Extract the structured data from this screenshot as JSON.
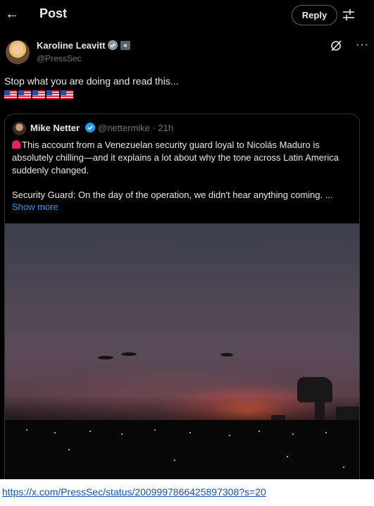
{
  "header": {
    "title": "Post",
    "reply_label": "Reply"
  },
  "author": {
    "name": "Karoline Leavitt",
    "handle": "@PressSec"
  },
  "tweet": {
    "text": "Stop what you are doing and read this..."
  },
  "quote": {
    "name": "Mike Netter",
    "handle": "@nettermike · 21h",
    "body": "This account from a Venezuelan security guard loyal to Nicolás Maduro is absolutely chilling—and it explains a lot about why the tone across Latin America suddenly changed.",
    "para2": "Security Guard: On the day of the operation, we didn't hear anything coming. ...",
    "show_more": "Show more"
  },
  "url": "https://x.com/PressSec/status/2009997866425897308?s=20",
  "colors": {
    "accent": "#1d9bf0",
    "background": "#000000",
    "text": "#e7e9ea",
    "muted": "#71767b"
  },
  "icons": [
    "back-arrow-icon",
    "settings-sliders-icon",
    "verified-badge-icon",
    "government-badge-icon",
    "grok-icon",
    "more-icon",
    "siren-icon",
    "us-flag-icon"
  ]
}
